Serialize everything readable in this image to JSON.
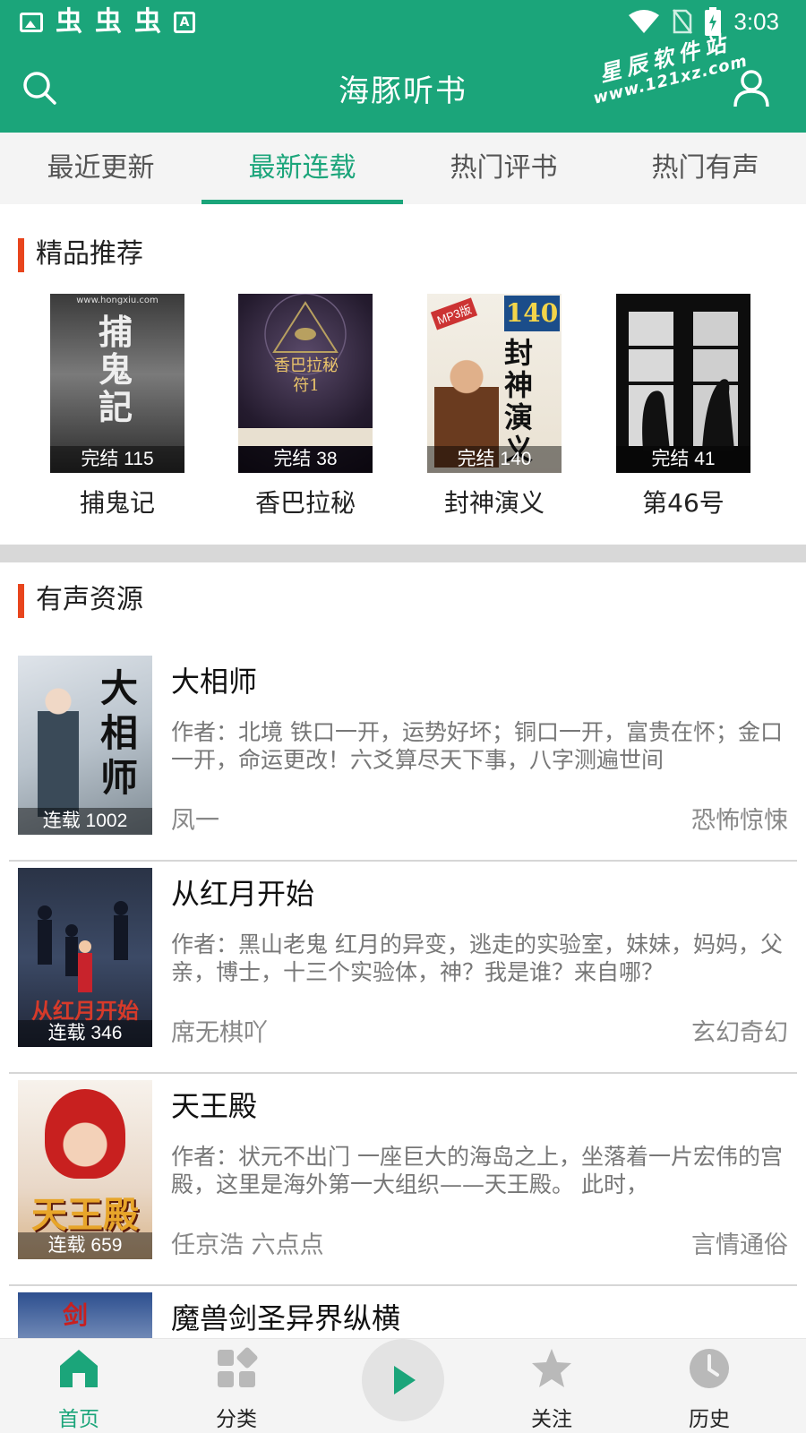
{
  "status": {
    "time": "3:03",
    "bug_glyphs": [
      "虫",
      "虫",
      "虫"
    ],
    "a_icon": "A"
  },
  "header": {
    "title": "海豚听书",
    "watermark_line1": "星辰软件站",
    "watermark_line2": "www.121xz.com"
  },
  "tabs": [
    {
      "label": "最近更新"
    },
    {
      "label": "最新连载"
    },
    {
      "label": "热门评书"
    },
    {
      "label": "热门有声"
    }
  ],
  "featured": {
    "title": "精品推荐",
    "items": [
      {
        "name": "捕鬼记",
        "badge": "完结 115",
        "cover_text": "捕鬼記",
        "cover_caption": "www.hongxiu.com"
      },
      {
        "name": "香巴拉秘",
        "badge": "完结 38",
        "cover_text": "香巴拉秘符1",
        "cover_caption": ""
      },
      {
        "name": "封神演义",
        "badge": "完结 140",
        "cover_text": "封神演义",
        "cover_caption": "140"
      },
      {
        "name": "第46号",
        "badge": "完结 41",
        "cover_text": "",
        "cover_caption": ""
      }
    ]
  },
  "audio": {
    "title": "有声资源",
    "items": [
      {
        "title": "大相师",
        "desc": "作者：北境 铁口一开，运势好坏；铜口一开，富贵在怀；金口一开，命运更改！六爻算尽天下事，八字测遍世间",
        "anchor": "凤一",
        "category": "恐怖惊悚",
        "badge": "连载 1002",
        "cover_text": "大相师"
      },
      {
        "title": "从红月开始",
        "desc": "作者：黑山老鬼 红月的异变，逃走的实验室，妹妹，妈妈，父亲，博士，十三个实验体，神？我是谁？来自哪？",
        "anchor": "席无棋吖",
        "category": "玄幻奇幻",
        "badge": "连载 346",
        "cover_text": "从红月开始"
      },
      {
        "title": "天王殿",
        "desc": "作者：状元不出门 一座巨大的海岛之上，坐落着一片宏伟的宫殿，这里是海外第一大组织——天王殿。 此时，",
        "anchor": "任京浩 六点点",
        "category": "言情通俗",
        "badge": "连载 659",
        "cover_text": "天王殿"
      },
      {
        "title": "魔兽剑圣异界纵横",
        "desc": "",
        "anchor": "",
        "category": "",
        "badge": "",
        "cover_text": "剑"
      }
    ]
  },
  "bottom_nav": [
    {
      "label": "首页",
      "icon": "home-icon"
    },
    {
      "label": "分类",
      "icon": "category-icon"
    },
    {
      "label": "",
      "icon": "play-icon"
    },
    {
      "label": "关注",
      "icon": "star-icon"
    },
    {
      "label": "历史",
      "icon": "clock-icon"
    }
  ],
  "colors": {
    "brand": "#1ba57a",
    "accent_bar": "#e8451d"
  }
}
